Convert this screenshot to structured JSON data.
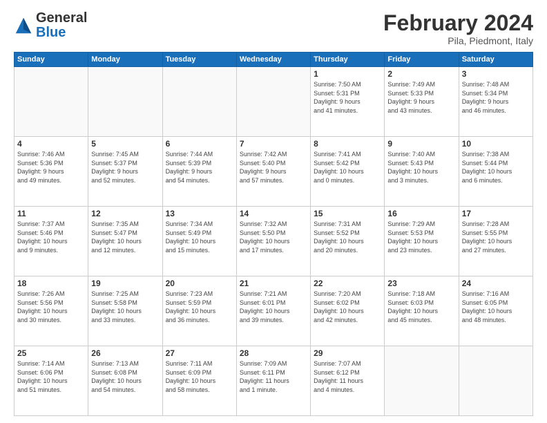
{
  "logo": {
    "general": "General",
    "blue": "Blue"
  },
  "header": {
    "title": "February 2024",
    "subtitle": "Pila, Piedmont, Italy"
  },
  "weekdays": [
    "Sunday",
    "Monday",
    "Tuesday",
    "Wednesday",
    "Thursday",
    "Friday",
    "Saturday"
  ],
  "weeks": [
    [
      {
        "day": "",
        "info": ""
      },
      {
        "day": "",
        "info": ""
      },
      {
        "day": "",
        "info": ""
      },
      {
        "day": "",
        "info": ""
      },
      {
        "day": "1",
        "info": "Sunrise: 7:50 AM\nSunset: 5:31 PM\nDaylight: 9 hours\nand 41 minutes."
      },
      {
        "day": "2",
        "info": "Sunrise: 7:49 AM\nSunset: 5:33 PM\nDaylight: 9 hours\nand 43 minutes."
      },
      {
        "day": "3",
        "info": "Sunrise: 7:48 AM\nSunset: 5:34 PM\nDaylight: 9 hours\nand 46 minutes."
      }
    ],
    [
      {
        "day": "4",
        "info": "Sunrise: 7:46 AM\nSunset: 5:36 PM\nDaylight: 9 hours\nand 49 minutes."
      },
      {
        "day": "5",
        "info": "Sunrise: 7:45 AM\nSunset: 5:37 PM\nDaylight: 9 hours\nand 52 minutes."
      },
      {
        "day": "6",
        "info": "Sunrise: 7:44 AM\nSunset: 5:39 PM\nDaylight: 9 hours\nand 54 minutes."
      },
      {
        "day": "7",
        "info": "Sunrise: 7:42 AM\nSunset: 5:40 PM\nDaylight: 9 hours\nand 57 minutes."
      },
      {
        "day": "8",
        "info": "Sunrise: 7:41 AM\nSunset: 5:42 PM\nDaylight: 10 hours\nand 0 minutes."
      },
      {
        "day": "9",
        "info": "Sunrise: 7:40 AM\nSunset: 5:43 PM\nDaylight: 10 hours\nand 3 minutes."
      },
      {
        "day": "10",
        "info": "Sunrise: 7:38 AM\nSunset: 5:44 PM\nDaylight: 10 hours\nand 6 minutes."
      }
    ],
    [
      {
        "day": "11",
        "info": "Sunrise: 7:37 AM\nSunset: 5:46 PM\nDaylight: 10 hours\nand 9 minutes."
      },
      {
        "day": "12",
        "info": "Sunrise: 7:35 AM\nSunset: 5:47 PM\nDaylight: 10 hours\nand 12 minutes."
      },
      {
        "day": "13",
        "info": "Sunrise: 7:34 AM\nSunset: 5:49 PM\nDaylight: 10 hours\nand 15 minutes."
      },
      {
        "day": "14",
        "info": "Sunrise: 7:32 AM\nSunset: 5:50 PM\nDaylight: 10 hours\nand 17 minutes."
      },
      {
        "day": "15",
        "info": "Sunrise: 7:31 AM\nSunset: 5:52 PM\nDaylight: 10 hours\nand 20 minutes."
      },
      {
        "day": "16",
        "info": "Sunrise: 7:29 AM\nSunset: 5:53 PM\nDaylight: 10 hours\nand 23 minutes."
      },
      {
        "day": "17",
        "info": "Sunrise: 7:28 AM\nSunset: 5:55 PM\nDaylight: 10 hours\nand 27 minutes."
      }
    ],
    [
      {
        "day": "18",
        "info": "Sunrise: 7:26 AM\nSunset: 5:56 PM\nDaylight: 10 hours\nand 30 minutes."
      },
      {
        "day": "19",
        "info": "Sunrise: 7:25 AM\nSunset: 5:58 PM\nDaylight: 10 hours\nand 33 minutes."
      },
      {
        "day": "20",
        "info": "Sunrise: 7:23 AM\nSunset: 5:59 PM\nDaylight: 10 hours\nand 36 minutes."
      },
      {
        "day": "21",
        "info": "Sunrise: 7:21 AM\nSunset: 6:01 PM\nDaylight: 10 hours\nand 39 minutes."
      },
      {
        "day": "22",
        "info": "Sunrise: 7:20 AM\nSunset: 6:02 PM\nDaylight: 10 hours\nand 42 minutes."
      },
      {
        "day": "23",
        "info": "Sunrise: 7:18 AM\nSunset: 6:03 PM\nDaylight: 10 hours\nand 45 minutes."
      },
      {
        "day": "24",
        "info": "Sunrise: 7:16 AM\nSunset: 6:05 PM\nDaylight: 10 hours\nand 48 minutes."
      }
    ],
    [
      {
        "day": "25",
        "info": "Sunrise: 7:14 AM\nSunset: 6:06 PM\nDaylight: 10 hours\nand 51 minutes."
      },
      {
        "day": "26",
        "info": "Sunrise: 7:13 AM\nSunset: 6:08 PM\nDaylight: 10 hours\nand 54 minutes."
      },
      {
        "day": "27",
        "info": "Sunrise: 7:11 AM\nSunset: 6:09 PM\nDaylight: 10 hours\nand 58 minutes."
      },
      {
        "day": "28",
        "info": "Sunrise: 7:09 AM\nSunset: 6:11 PM\nDaylight: 11 hours\nand 1 minute."
      },
      {
        "day": "29",
        "info": "Sunrise: 7:07 AM\nSunset: 6:12 PM\nDaylight: 11 hours\nand 4 minutes."
      },
      {
        "day": "",
        "info": ""
      },
      {
        "day": "",
        "info": ""
      }
    ]
  ]
}
